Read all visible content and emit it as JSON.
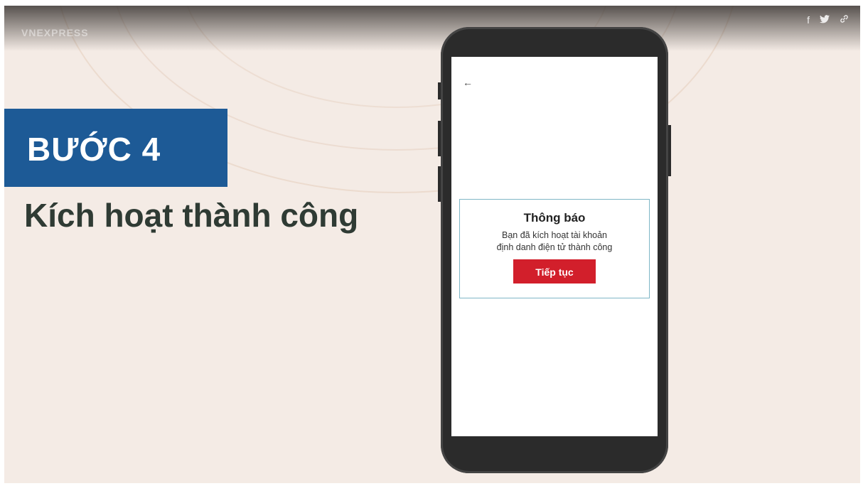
{
  "brand": {
    "text": "VNEXPRESS"
  },
  "social": {
    "facebook": "f",
    "twitter": "•",
    "link": "•"
  },
  "step": {
    "label": "BƯỚC 4"
  },
  "subtitle": "Kích hoạt thành công",
  "phone": {
    "back_label": "←",
    "dialog": {
      "title": "Thông báo",
      "message_line1": "Bạn đã kích hoạt tài khoản",
      "message_line2": "định danh điện tử thành công",
      "button_label": "Tiếp tục"
    }
  },
  "colors": {
    "step_bg": "#1d5a96",
    "button_bg": "#d21f2b",
    "dialog_border": "#7fb6c6"
  }
}
